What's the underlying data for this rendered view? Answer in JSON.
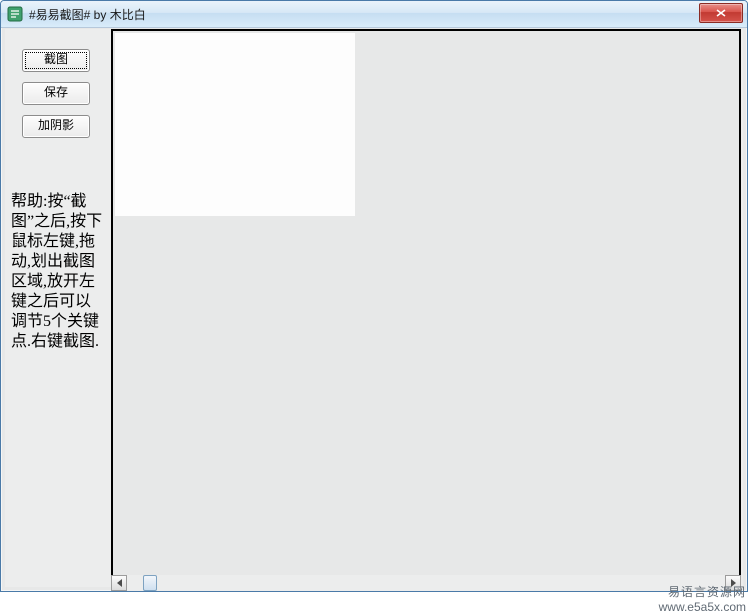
{
  "window": {
    "title": "#易易截图#    by 木比白"
  },
  "sidebar": {
    "buttons": {
      "screenshot": "截图",
      "save": "保存",
      "shadow": "加阴影"
    },
    "help_text": "帮助:按“截图”之后,按下鼠标左键,拖动,划出截图区域,放开左键之后可以调节5个关键点.右键截图."
  },
  "watermark": {
    "line1": "易语言资源网",
    "line2": "www.e5a5x.com"
  }
}
